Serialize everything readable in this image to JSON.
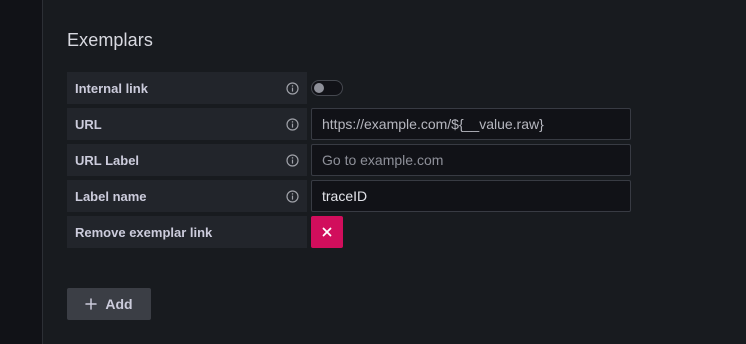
{
  "section": {
    "title": "Exemplars"
  },
  "rows": {
    "internal_link": {
      "label": "Internal link",
      "toggle_on": false
    },
    "url": {
      "label": "URL",
      "value": "https://example.com/${__value.raw}",
      "placeholder": ""
    },
    "url_label": {
      "label": "URL Label",
      "value": "",
      "placeholder": "Go to example.com"
    },
    "label_name": {
      "label": "Label name",
      "value": "traceID",
      "placeholder": ""
    },
    "remove": {
      "label": "Remove exemplar link",
      "button_glyph": "×"
    }
  },
  "add_button": {
    "label": "Add",
    "icon": "plus-icon"
  },
  "colors": {
    "background": "#181b1f",
    "label_bg": "#22252b",
    "input_bg": "#111217",
    "danger": "#d10e5c",
    "secondary_button": "#3b3e45"
  },
  "icons": {
    "info": "info-circle-icon",
    "remove": "close-icon",
    "add": "plus-icon"
  }
}
